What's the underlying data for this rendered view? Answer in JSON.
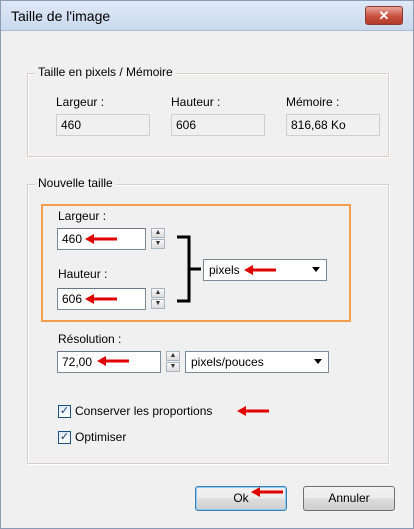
{
  "dialog": {
    "title": "Taille de l'image",
    "close_glyph": "✕"
  },
  "pixel_memory": {
    "legend": "Taille en pixels / Mémoire",
    "width_label": "Largeur :",
    "height_label": "Hauteur :",
    "memory_label": "Mémoire :",
    "width_value": "460",
    "height_value": "606",
    "memory_value": "816,68 Ko"
  },
  "new_size": {
    "legend": "Nouvelle taille",
    "width_label": "Largeur :",
    "width_value": "460",
    "height_label": "Hauteur :",
    "height_value": "606",
    "unit_value": "pixels",
    "resolution_label": "Résolution :",
    "resolution_value": "72,00",
    "resolution_unit_value": "pixels/pouces",
    "keep_proportions_label": "Conserver les proportions",
    "keep_proportions_checked": true,
    "optimize_label": "Optimiser",
    "optimize_checked": true,
    "check_glyph": "✓"
  },
  "buttons": {
    "ok_label": "Ok",
    "cancel_label": "Annuler"
  },
  "spinner": {
    "up_glyph": "▲",
    "down_glyph": "▼"
  },
  "annotation_color": "#e00000",
  "highlight_color": "#f59d4f"
}
